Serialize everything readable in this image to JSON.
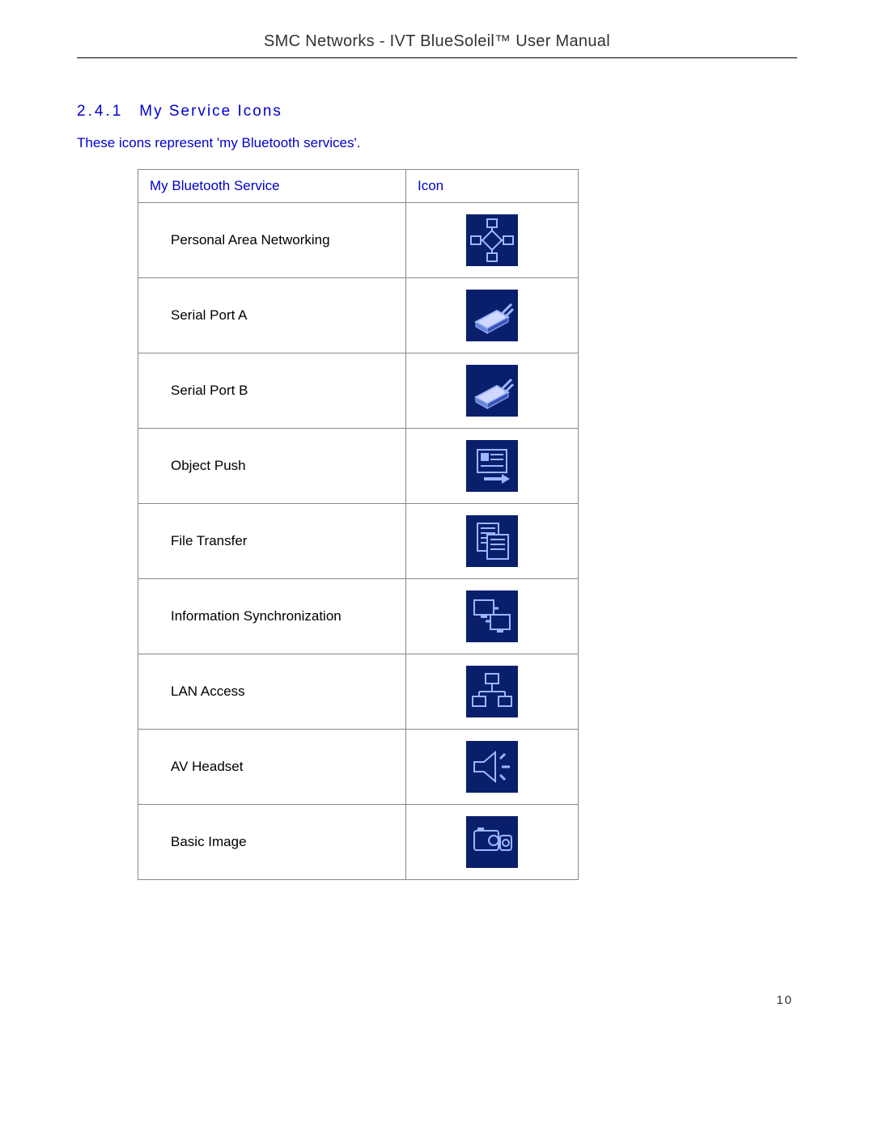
{
  "header": {
    "title": "SMC Networks - IVT BlueSoleil™ User Manual"
  },
  "section": {
    "number": "2.4.1",
    "title": "My Service Icons",
    "intro": "These icons represent 'my Bluetooth services'."
  },
  "table": {
    "headers": {
      "service": "My Bluetooth Service",
      "icon": "Icon"
    },
    "rows": [
      {
        "label": "Personal Area Networking",
        "icon": "pan-icon"
      },
      {
        "label": "Serial Port A",
        "icon": "serial-port-a-icon"
      },
      {
        "label": "Serial Port B",
        "icon": "serial-port-b-icon"
      },
      {
        "label": "Object Push",
        "icon": "object-push-icon"
      },
      {
        "label": "File Transfer",
        "icon": "file-transfer-icon"
      },
      {
        "label": "Information Synchronization",
        "icon": "info-sync-icon"
      },
      {
        "label": "LAN Access",
        "icon": "lan-access-icon"
      },
      {
        "label": "AV Headset",
        "icon": "av-headset-icon"
      },
      {
        "label": "Basic Image",
        "icon": "basic-image-icon"
      }
    ]
  },
  "footer": {
    "page_number": "10"
  }
}
